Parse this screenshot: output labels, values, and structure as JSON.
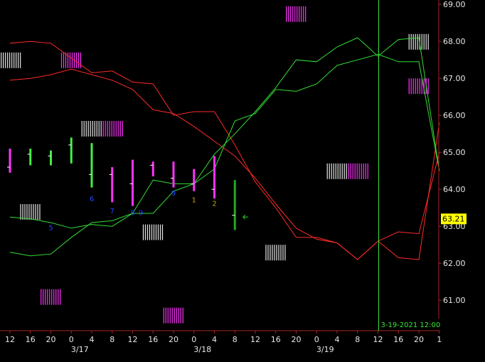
{
  "chart_data": {
    "type": "line",
    "ylim": [
      60.1,
      69.1
    ],
    "y_ticks": [
      61,
      62,
      63,
      64,
      65,
      66,
      67,
      68,
      69
    ],
    "y_tick_labels": [
      "61.00",
      "62.00",
      "63.00",
      "64.00",
      "65.00",
      "66.00",
      "67.00",
      "68.00",
      "69.00"
    ],
    "x_tick_labels": [
      "12",
      "16",
      "20",
      "0",
      "4",
      "8",
      "12",
      "16",
      "20",
      "0",
      "4",
      "8",
      "12",
      "16",
      "20",
      "0",
      "4",
      "8",
      "12",
      "16",
      "20",
      "1"
    ],
    "date_labels": [
      {
        "label": "3/17",
        "slot": 3
      },
      {
        "label": "3/18",
        "slot": 9
      },
      {
        "label": "3/19",
        "slot": 15
      }
    ],
    "last_price": "63.21",
    "cursor": {
      "label": "3-19-2021 12:00",
      "slot": 18
    },
    "series": [
      {
        "color": "#ff2a2a",
        "values": [
          67.95,
          68.0,
          67.95,
          67.55,
          67.15,
          67.2,
          66.9,
          66.85,
          66.0,
          66.1,
          66.1,
          65.2,
          64.2,
          63.5,
          62.7,
          62.7,
          62.55,
          62.1,
          62.6,
          62.15,
          62.1,
          65.8
        ]
      },
      {
        "color": "#ff2a2a",
        "values": [
          66.95,
          67.0,
          67.1,
          67.25,
          67.1,
          66.95,
          66.7,
          66.15,
          66.05,
          65.7,
          65.3,
          64.9,
          64.3,
          63.6,
          62.95,
          62.65,
          62.55,
          62.1,
          62.6,
          62.85,
          62.8,
          65.0
        ]
      },
      {
        "color": "#33dd33",
        "values": [
          63.25,
          63.2,
          63.1,
          62.95,
          63.05,
          63.0,
          63.35,
          63.35,
          63.95,
          64.15,
          64.95,
          65.5,
          66.1,
          66.75,
          67.5,
          67.45,
          67.85,
          68.1,
          67.6,
          68.05,
          68.1,
          64.5
        ]
      },
      {
        "color": "#33dd33",
        "values": [
          62.3,
          62.2,
          62.25,
          62.7,
          63.1,
          63.15,
          63.35,
          64.25,
          64.15,
          64.15,
          64.55,
          65.85,
          66.05,
          66.7,
          66.65,
          66.85,
          67.35,
          67.5,
          67.65,
          67.45,
          67.45,
          64.5
        ]
      }
    ],
    "bars": [
      {
        "slot": 0,
        "low": 64.45,
        "high": 65.1,
        "close": 64.6,
        "color": "#ff33ff"
      },
      {
        "slot": 1,
        "low": 64.65,
        "high": 65.1,
        "close": 64.95,
        "color": "#44ee44"
      },
      {
        "slot": 2,
        "low": 64.65,
        "high": 65.05,
        "close": 64.9,
        "color": "#44ee44"
      },
      {
        "slot": 3,
        "low": 64.7,
        "high": 65.4,
        "close": 65.2,
        "color": "#44ee44"
      },
      {
        "slot": 4,
        "low": 64.05,
        "high": 65.25,
        "close": 64.4,
        "color": "#44ee44"
      },
      {
        "slot": 5,
        "low": 63.65,
        "high": 64.6,
        "close": 64.4,
        "color": "#ff33ff"
      },
      {
        "slot": 6,
        "low": 63.55,
        "high": 64.8,
        "close": 64.15,
        "color": "#ff33ff"
      },
      {
        "slot": 7,
        "low": 64.35,
        "high": 64.75,
        "close": 64.65,
        "color": "#ff33ff"
      },
      {
        "slot": 8,
        "low": 64.05,
        "high": 64.75,
        "close": 64.3,
        "color": "#ff33ff"
      },
      {
        "slot": 9,
        "low": 63.95,
        "high": 64.55,
        "close": 64.15,
        "color": "#ff33ff"
      },
      {
        "slot": 10,
        "low": 63.75,
        "high": 64.9,
        "close": 64.0,
        "color": "#ff33ff"
      },
      {
        "slot": 11,
        "low": 62.9,
        "high": 64.25,
        "close": 63.3,
        "color": "#22aa22"
      }
    ],
    "bar_numbers": [
      {
        "slot": 2,
        "value": 62.9,
        "label": "5",
        "color": "#2244ff"
      },
      {
        "slot": 4,
        "value": 63.68,
        "label": "6",
        "color": "#2244ff"
      },
      {
        "slot": 5,
        "value": 63.35,
        "label": "7",
        "color": "#2244ff"
      },
      {
        "slot": 6,
        "value": 63.3,
        "label": "8",
        "color": "#2244ff"
      },
      {
        "slot": 6.4,
        "value": 63.3,
        "label": "9",
        "color": "#2244ff"
      },
      {
        "slot": 8,
        "value": 63.83,
        "label": "9",
        "color": "#2244ff"
      },
      {
        "slot": 9,
        "value": 63.65,
        "label": "1",
        "color": "#c8a010"
      },
      {
        "slot": 10,
        "value": 63.55,
        "label": "2",
        "color": "#c8a010"
      }
    ],
    "arrow": {
      "slot": 11.4,
      "value": 63.25,
      "color": "#22aa22"
    },
    "stripe_blocks": [
      {
        "slot": -0.45,
        "value": 67.7,
        "colors": [
          "white"
        ]
      },
      {
        "slot": 2.5,
        "value": 67.7,
        "colors": [
          "magenta"
        ]
      },
      {
        "slot": 13.5,
        "value": 68.95,
        "colors": [
          "magenta"
        ]
      },
      {
        "slot": 3.5,
        "value": 65.85,
        "colors": [
          "white",
          "magenta"
        ]
      },
      {
        "slot": 15.5,
        "value": 64.7,
        "colors": [
          "white",
          "magenta"
        ]
      },
      {
        "slot": 0.5,
        "value": 63.6,
        "colors": [
          "white"
        ]
      },
      {
        "slot": 6.5,
        "value": 63.05,
        "colors": [
          "white"
        ]
      },
      {
        "slot": 12.5,
        "value": 62.5,
        "colors": [
          "white"
        ]
      },
      {
        "slot": 19.5,
        "value": 68.2,
        "colors": [
          "white"
        ]
      },
      {
        "slot": 19.5,
        "value": 67.0,
        "colors": [
          "magenta"
        ]
      },
      {
        "slot": 1.5,
        "value": 61.3,
        "colors": [
          "magenta"
        ]
      },
      {
        "slot": 7.5,
        "value": 60.8,
        "colors": [
          "magenta"
        ]
      }
    ],
    "colors": {
      "background": "#000000",
      "red": "#ff2a2a",
      "green": "#33dd33",
      "magenta": "#ff33ff",
      "cursor": "#39e639",
      "price_label_bg": "#ffff00",
      "axis": "#aa2222"
    }
  }
}
